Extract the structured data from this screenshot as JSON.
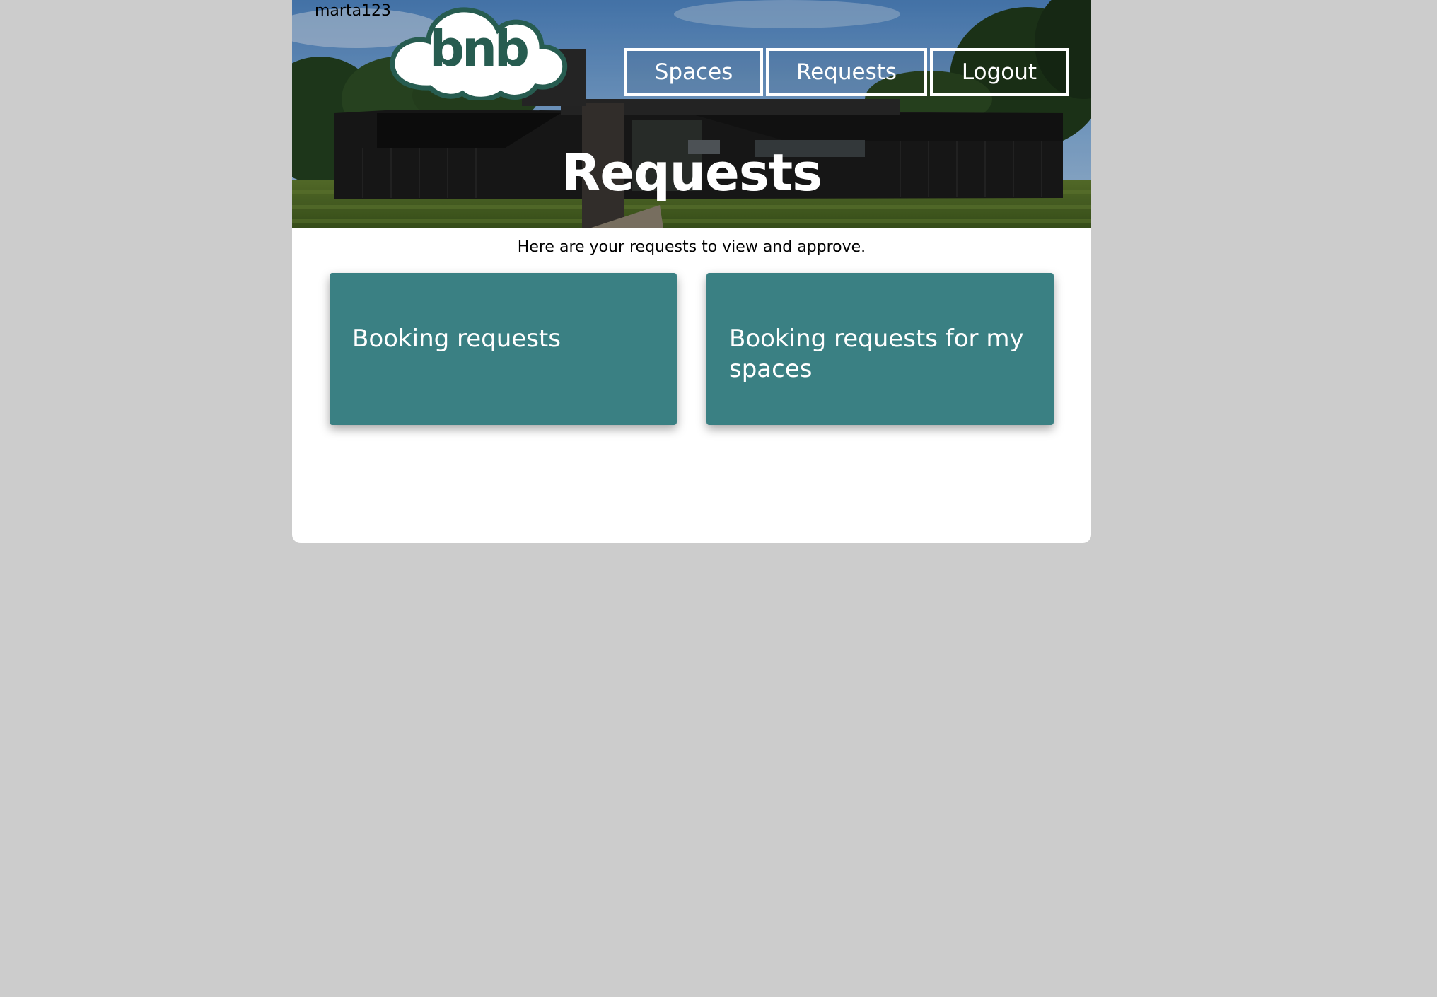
{
  "header": {
    "username": "marta123",
    "logo_text": "bnb",
    "nav": {
      "spaces_label": "Spaces",
      "requests_label": "Requests",
      "logout_label": "Logout"
    },
    "page_title": "Requests"
  },
  "main": {
    "subtitle": "Here are your requests to view and approve.",
    "cards": [
      {
        "title": "Booking requests"
      },
      {
        "title": "Booking requests for my spaces"
      }
    ]
  },
  "colors": {
    "background": "#cccccc",
    "card": "#3a8083",
    "logo_text": "#275c50"
  }
}
